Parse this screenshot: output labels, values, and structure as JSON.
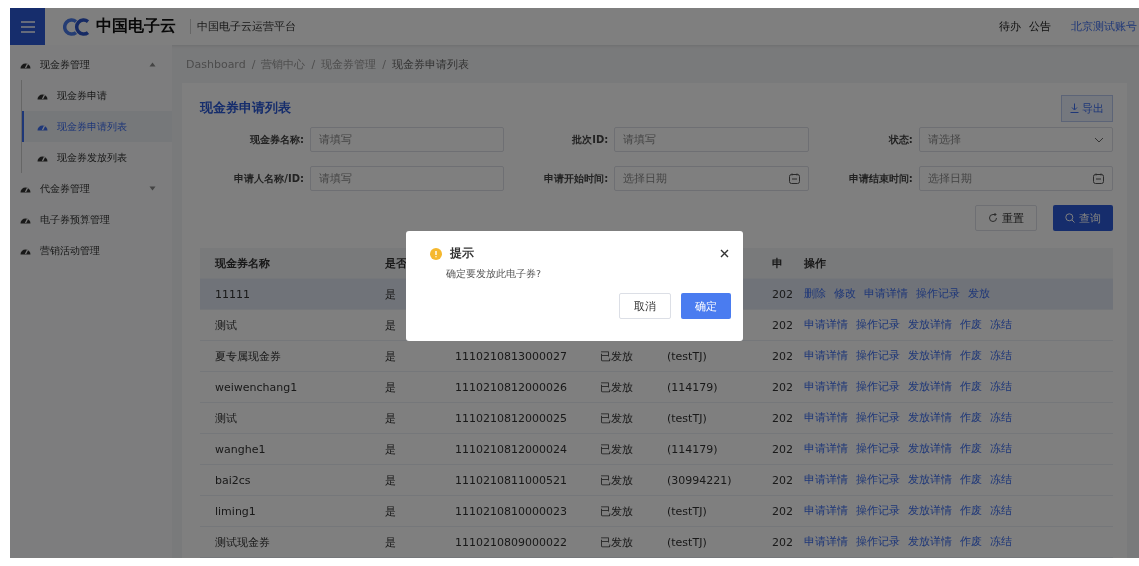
{
  "topbar": {
    "logo_text": "中国电子云",
    "platform": "中国电子云运营平台",
    "links": [
      "待办",
      "公告"
    ],
    "account": "北京测试账号"
  },
  "sidebar": {
    "items": [
      {
        "label": "现金券管理",
        "expanded": true,
        "children": [
          {
            "label": "现金券申请",
            "selected": false
          },
          {
            "label": "现金券申请列表",
            "selected": true
          },
          {
            "label": "现金券发放列表",
            "selected": false
          }
        ]
      },
      {
        "label": "代金券管理",
        "expanded": false
      },
      {
        "label": "电子券预算管理"
      },
      {
        "label": "营销活动管理"
      }
    ]
  },
  "breadcrumb": {
    "separator": "/",
    "items": [
      "Dashboard",
      "营销中心",
      "现金券管理",
      "现金券申请列表"
    ]
  },
  "card": {
    "title": "现金券申请列表",
    "export_button": "导出"
  },
  "filters": [
    {
      "label": "现金券名称:",
      "placeholder": "请填写",
      "kind": "text"
    },
    {
      "label": "批次ID:",
      "placeholder": "请填写",
      "kind": "text"
    },
    {
      "label": "状态:",
      "placeholder": "请选择",
      "kind": "select"
    },
    {
      "label": "申请人名称/ID:",
      "placeholder": "请填写",
      "kind": "text"
    },
    {
      "label": "申请开始时间:",
      "placeholder": "选择日期",
      "kind": "date"
    },
    {
      "label": "申请结束时间:",
      "placeholder": "选择日期",
      "kind": "date"
    }
  ],
  "buttons": {
    "reset": "重置",
    "search": "查询"
  },
  "table": {
    "columns": [
      "现金券名称",
      "是否",
      "",
      "",
      "",
      "申",
      "操作"
    ],
    "rows": [
      {
        "selected": true,
        "name": "11111",
        "flag": "是",
        "date": "202",
        "actions": [
          "删除",
          "修改",
          "申请详情",
          "操作记录",
          "发放"
        ]
      },
      {
        "selected": false,
        "name": "测试",
        "flag": "是",
        "date": "202",
        "actions": [
          "申请详情",
          "操作记录",
          "发放详情",
          "作废",
          "冻结"
        ]
      },
      {
        "selected": false,
        "name": "夏专属现金券",
        "flag": "是",
        "batch_id": "1110210813000027",
        "status": "已发放",
        "applicant": "(testTJ)",
        "date": "202",
        "actions": [
          "申请详情",
          "操作记录",
          "发放详情",
          "作废",
          "冻结"
        ]
      },
      {
        "selected": false,
        "name": "weiwenchang1",
        "flag": "是",
        "batch_id": "1110210812000026",
        "status": "已发放",
        "applicant": "(114179)",
        "date": "202",
        "actions": [
          "申请详情",
          "操作记录",
          "发放详情",
          "作废",
          "冻结"
        ]
      },
      {
        "selected": false,
        "name": "测试",
        "flag": "是",
        "batch_id": "1110210812000025",
        "status": "已发放",
        "applicant": "(testTJ)",
        "date": "202",
        "actions": [
          "申请详情",
          "操作记录",
          "发放详情",
          "作废",
          "冻结"
        ]
      },
      {
        "selected": false,
        "name": "wanghe1",
        "flag": "是",
        "batch_id": "1110210812000024",
        "status": "已发放",
        "applicant": "(114179)",
        "date": "202",
        "actions": [
          "申请详情",
          "操作记录",
          "发放详情",
          "作废",
          "冻结"
        ]
      },
      {
        "selected": false,
        "name": "bai2cs",
        "flag": "是",
        "batch_id": "1110210811000521",
        "status": "已发放",
        "applicant": "(30994221)",
        "date": "202",
        "actions": [
          "申请详情",
          "操作记录",
          "发放详情",
          "作废",
          "冻结"
        ]
      },
      {
        "selected": false,
        "name": "liming1",
        "flag": "是",
        "batch_id": "1110210810000023",
        "status": "已发放",
        "applicant": "(testTJ)",
        "date": "202",
        "actions": [
          "申请详情",
          "操作记录",
          "发放详情",
          "作废",
          "冻结"
        ]
      },
      {
        "selected": false,
        "name": "测试现金券",
        "flag": "是",
        "batch_id": "1110210809000022",
        "status": "已发放",
        "applicant": "(testTJ)",
        "date": "202",
        "actions": [
          "申请详情",
          "操作记录",
          "发放详情",
          "作废",
          "冻结"
        ]
      }
    ]
  },
  "dialog": {
    "title": "提示",
    "message": "确定要发放此电子券?",
    "cancel": "取消",
    "confirm": "确定"
  }
}
